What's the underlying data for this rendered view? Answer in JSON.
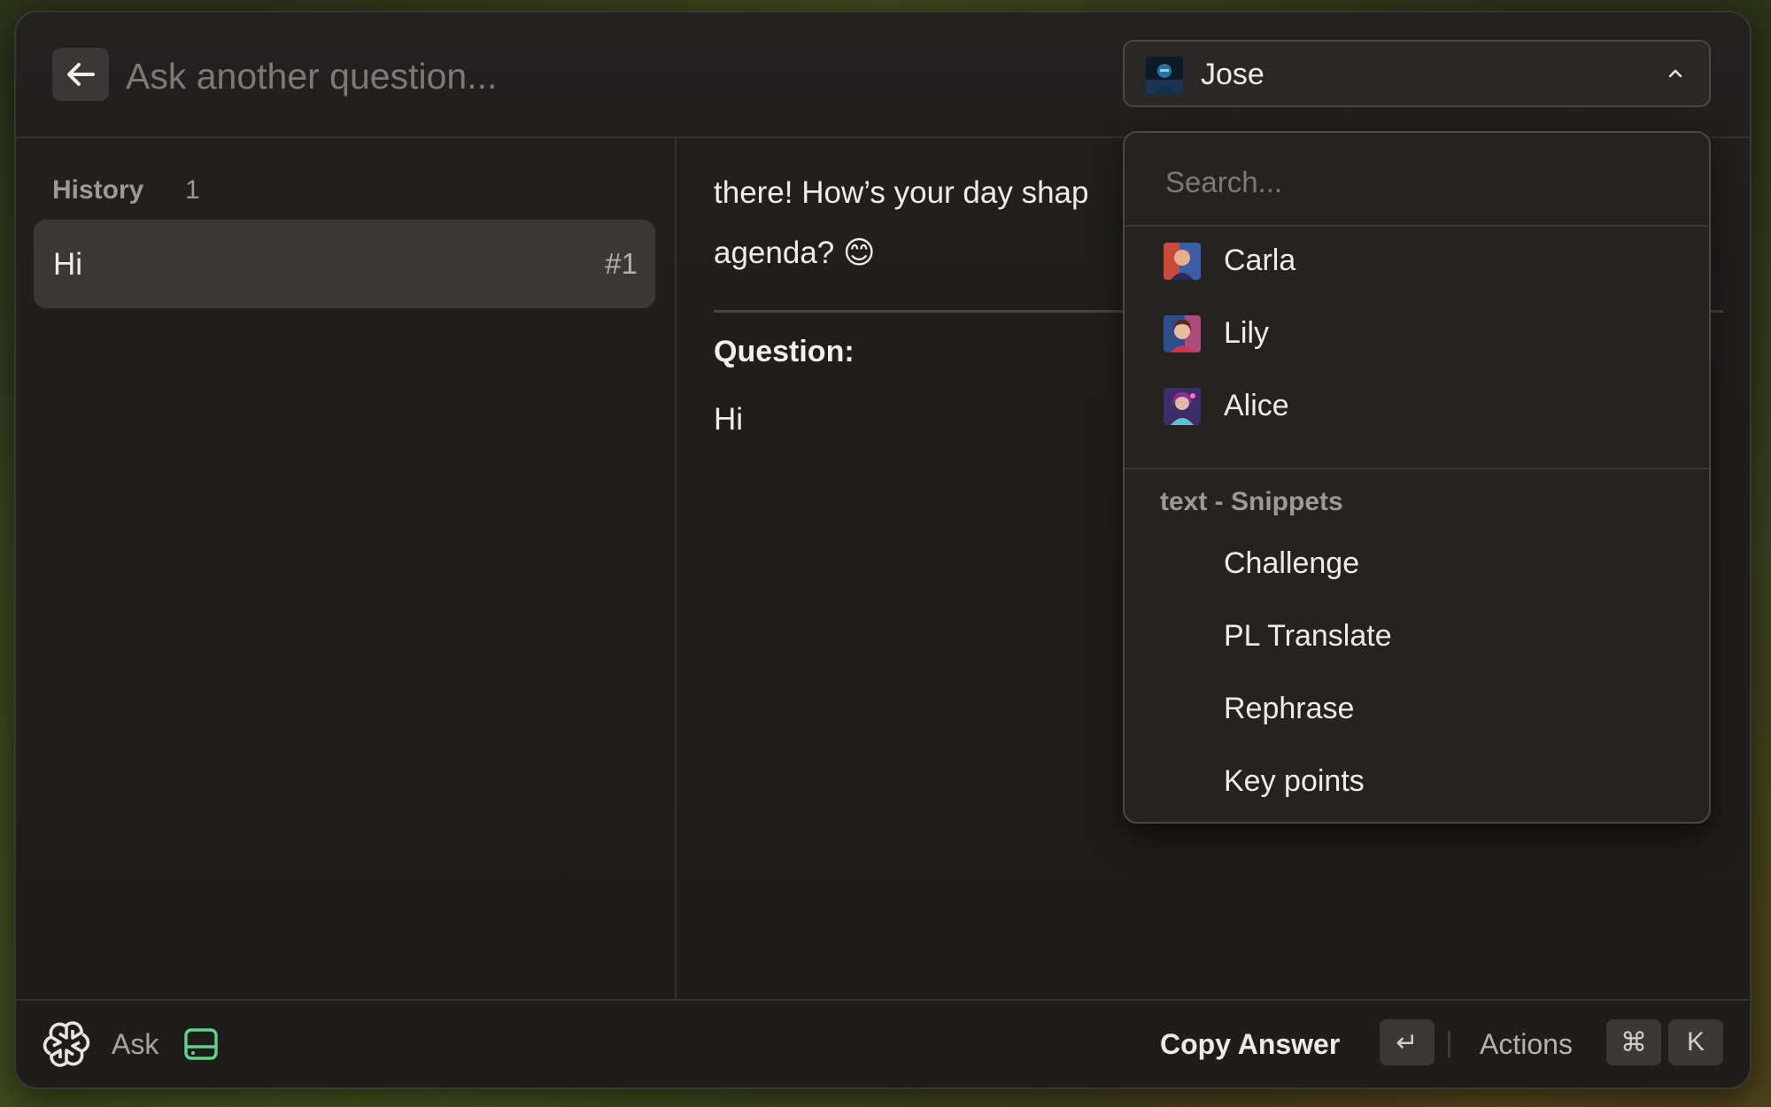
{
  "header": {
    "query_placeholder": "Ask another question...",
    "selected_persona": "Jose"
  },
  "sidebar": {
    "title": "History",
    "count": "1",
    "items": [
      {
        "label": "Hi",
        "number": "#1"
      }
    ]
  },
  "main": {
    "answer_line1": "there! How’s your day shap",
    "answer_line2": "agenda? 😊",
    "question_label": "Question:",
    "question_text": "Hi"
  },
  "dropdown": {
    "search_placeholder": "Search...",
    "personas": [
      {
        "name": "Carla"
      },
      {
        "name": "Lily"
      },
      {
        "name": "Alice"
      }
    ],
    "section_title": "text - Snippets",
    "snippets": [
      "Challenge",
      "PL Translate",
      "Rephrase",
      "Key points"
    ]
  },
  "footer": {
    "ask_label": "Ask",
    "copy_label": "Copy Answer",
    "copy_key": "↵",
    "actions_label": "Actions",
    "actions_key_1": "⌘",
    "actions_key_2": "K"
  },
  "colors": {
    "accent_green": "#5fd38a"
  }
}
